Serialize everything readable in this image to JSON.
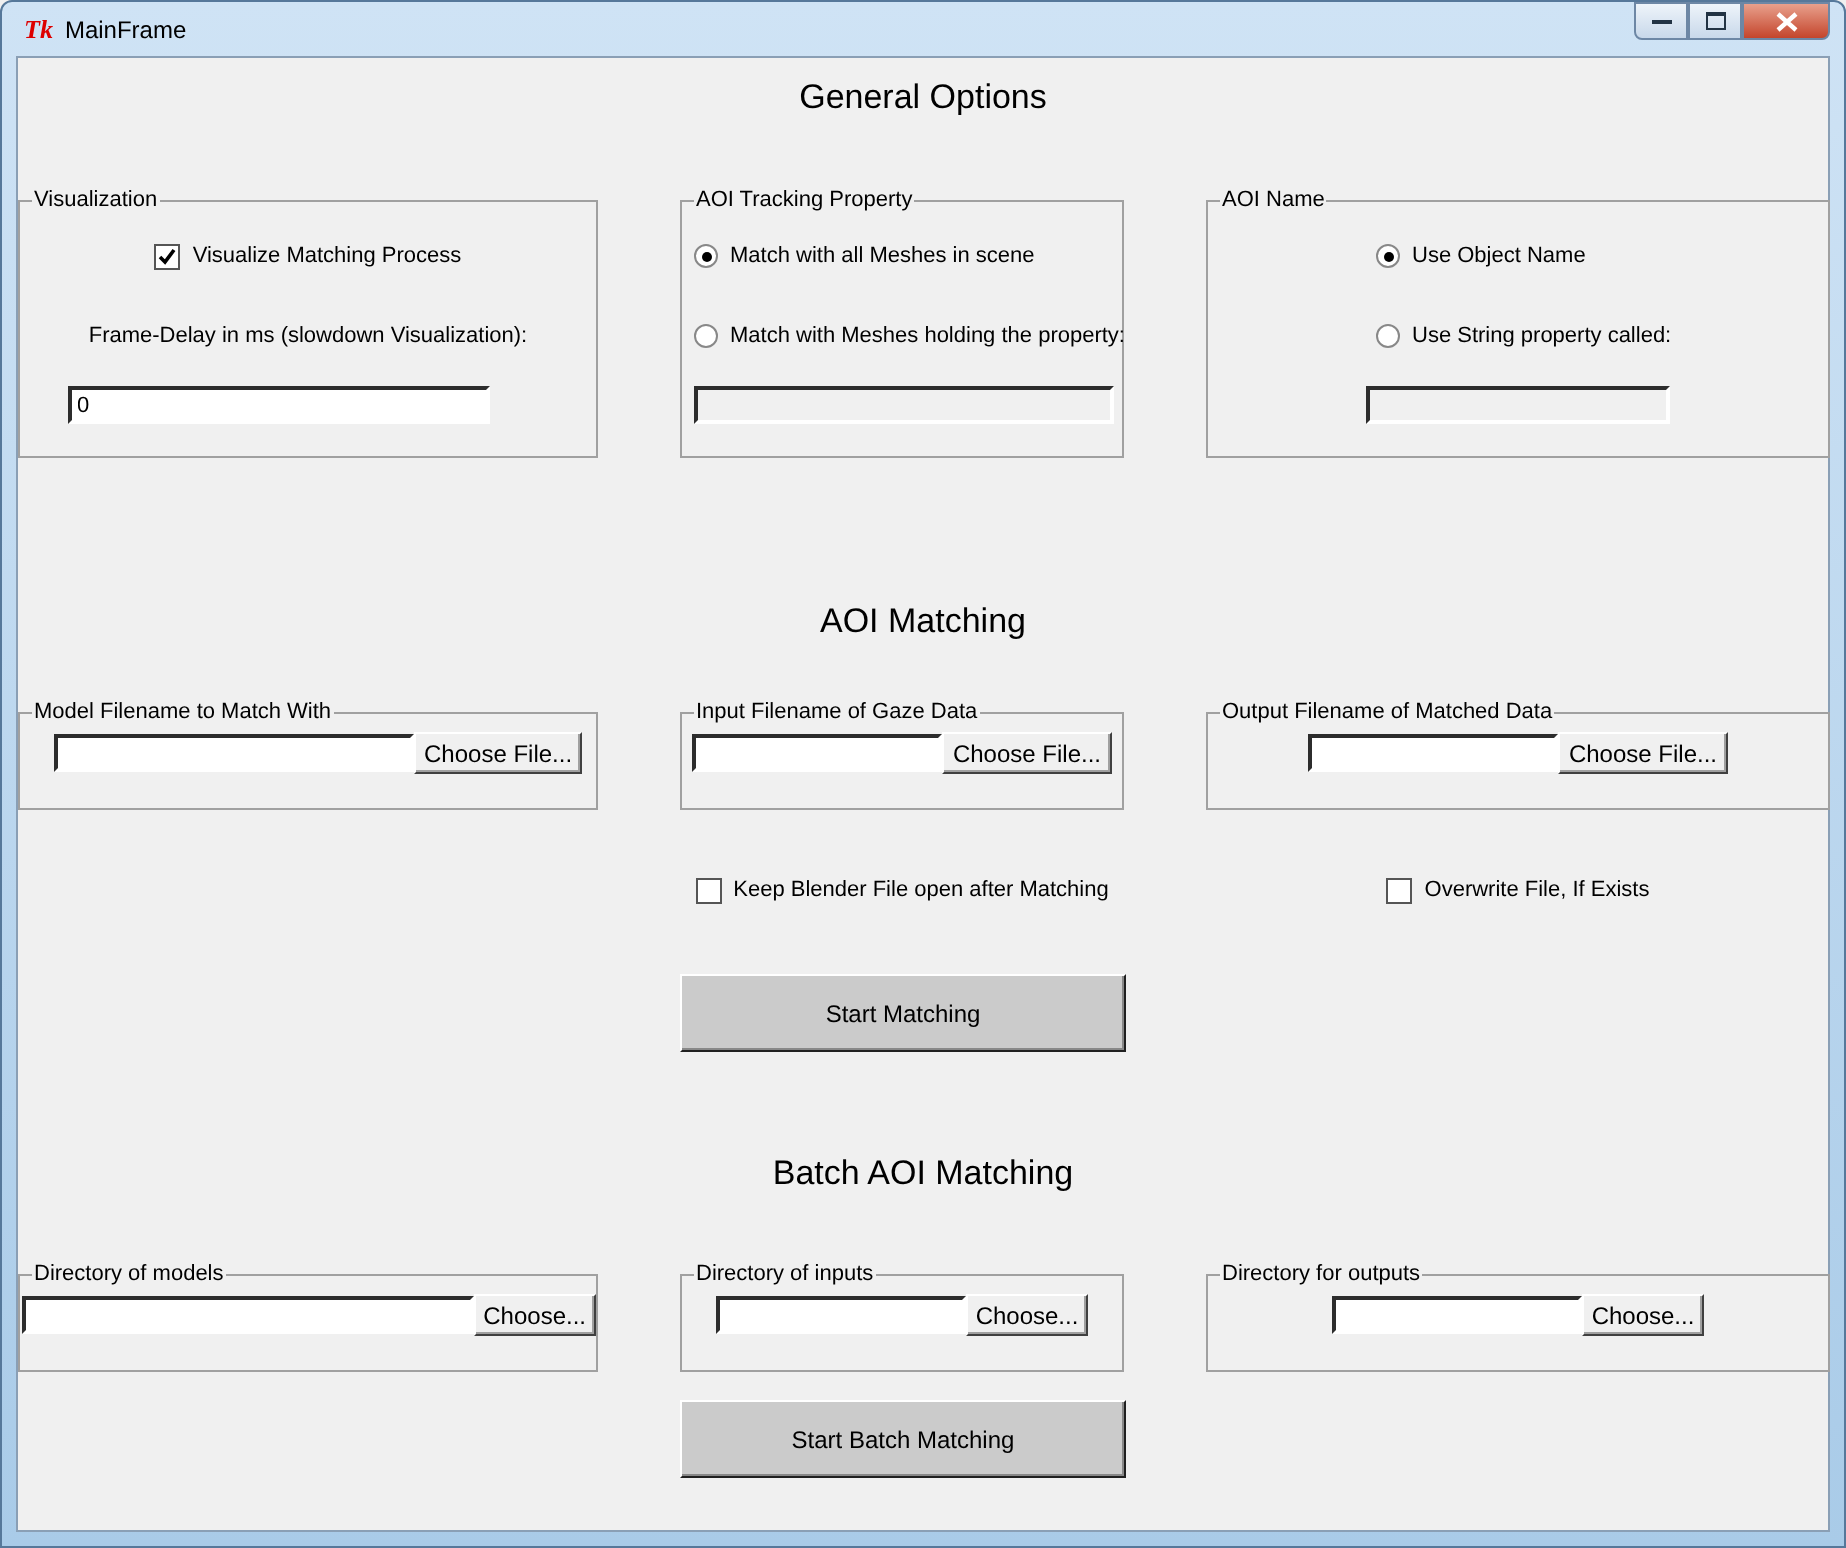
{
  "window": {
    "title": "MainFrame",
    "app_icon": "Tk"
  },
  "sections": [
    {
      "heading": "General Options",
      "groups": [
        {
          "title": "Visualization",
          "items": [
            {
              "kind": "checkbox",
              "label": "Visualize Matching Process",
              "checked": true
            },
            {
              "kind": "text",
              "text": "Frame-Delay in ms (slowdown Visualization):"
            },
            {
              "kind": "field",
              "value": "0",
              "disabled": false
            }
          ]
        },
        {
          "title": "AOI Tracking Property",
          "items": [
            {
              "kind": "radio",
              "label": "Match with all Meshes in scene",
              "selected": true
            },
            {
              "kind": "radio",
              "label": "Match with Meshes holding the property:",
              "selected": false
            },
            {
              "kind": "field",
              "disabled": true
            }
          ]
        },
        {
          "title": "AOI Name",
          "items": [
            {
              "kind": "radio",
              "label": "Use Object Name",
              "selected": true
            },
            {
              "kind": "radio",
              "label": "Use String property called:",
              "selected": false
            },
            {
              "kind": "field",
              "disabled": true
            }
          ]
        }
      ]
    },
    {
      "heading": "AOI Matching",
      "groups": [
        {
          "title": "Model Filename to Match With",
          "items": [
            {
              "kind": "file",
              "button": "Choose File..."
            }
          ]
        },
        {
          "title": "Input Filename of Gaze Data",
          "items": [
            {
              "kind": "file",
              "button": "Choose File..."
            }
          ]
        },
        {
          "title": "Output Filename of Matched Data",
          "items": [
            {
              "kind": "file",
              "button": "Choose File..."
            }
          ]
        }
      ],
      "options": [
        {
          "label": "Keep Blender File open after Matching",
          "checked": false
        },
        {
          "label": "Overwrite File, If Exists",
          "checked": false
        }
      ],
      "button": "Start Matching"
    },
    {
      "heading": "Batch AOI Matching",
      "groups": [
        {
          "title": "Directory of models",
          "items": [
            {
              "kind": "file",
              "button": "Choose..."
            }
          ]
        },
        {
          "title": "Directory of inputs",
          "items": [
            {
              "kind": "file",
              "button": "Choose..."
            }
          ]
        },
        {
          "title": "Directory for outputs",
          "items": [
            {
              "kind": "file",
              "button": "Choose..."
            }
          ]
        }
      ],
      "button": "Start Batch Matching"
    }
  ]
}
